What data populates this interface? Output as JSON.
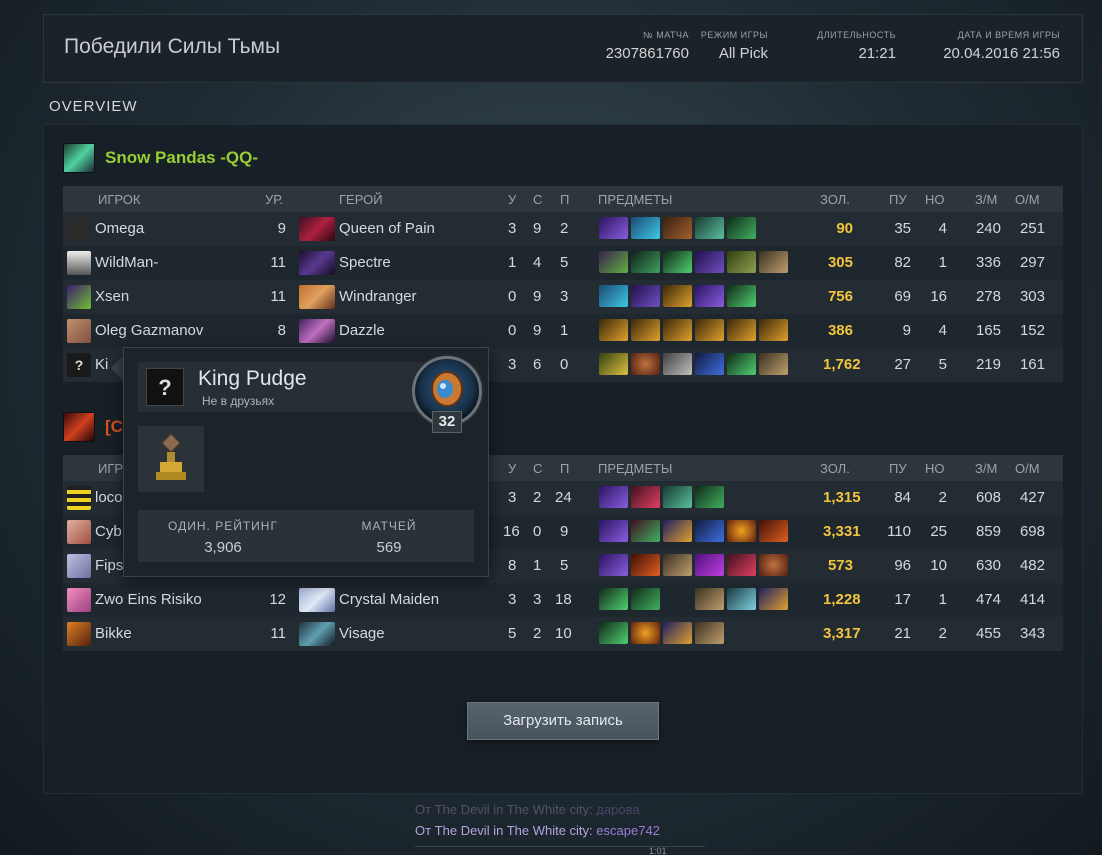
{
  "header": {
    "result": "Победили Силы Тьмы",
    "match_label": "№ МАТЧА",
    "match_value": "2307861760",
    "mode_label": "РЕЖИМ ИГРЫ",
    "mode_value": "All Pick",
    "duration_label": "ДЛИТЕЛЬНОСТЬ",
    "duration_value": "21:21",
    "date_label": "ДАТА И ВРЕМЯ ИГРЫ",
    "date_value": "20.04.2016 21:56"
  },
  "overview_label": "OVERVIEW",
  "columns": {
    "player": "ИГРОК",
    "level": "УР.",
    "hero": "ГЕРОЙ",
    "kills": "У",
    "deaths": "С",
    "assists": "П",
    "items": "ПРЕДМЕТЫ",
    "gold": "ЗОЛ.",
    "lh": "ПУ",
    "dn": "НО",
    "gpm": "З/М",
    "xpm": "О/М"
  },
  "colors": {
    "radiant": "#9acd32",
    "dire": "#d9531e",
    "gold": "#f2c53d"
  },
  "teams": [
    {
      "name": "Snow Pandas -QQ-",
      "players": [
        {
          "player": "Omega",
          "level": "9",
          "hero": "Queen of Pain",
          "k": "3",
          "d": "9",
          "a": "2",
          "gold": "90",
          "lh": "35",
          "dn": "4",
          "gpm": "240",
          "xpm": "251"
        },
        {
          "player": "WildMan-",
          "level": "11",
          "hero": "Spectre",
          "k": "1",
          "d": "4",
          "a": "5",
          "gold": "305",
          "lh": "82",
          "dn": "1",
          "gpm": "336",
          "xpm": "297"
        },
        {
          "player": "Xsen",
          "level": "11",
          "hero": "Windranger",
          "k": "0",
          "d": "9",
          "a": "3",
          "gold": "756",
          "lh": "69",
          "dn": "16",
          "gpm": "278",
          "xpm": "303"
        },
        {
          "player": "Oleg Gazmanov",
          "level": "8",
          "hero": "Dazzle",
          "k": "0",
          "d": "9",
          "a": "1",
          "gold": "386",
          "lh": "9",
          "dn": "4",
          "gpm": "165",
          "xpm": "152"
        },
        {
          "player": "Ki",
          "level": "",
          "hero": "",
          "k": "3",
          "d": "6",
          "a": "0",
          "gold": "1,762",
          "lh": "27",
          "dn": "5",
          "gpm": "219",
          "xpm": "161"
        }
      ]
    },
    {
      "name": "[C",
      "players": [
        {
          "player": "loco",
          "level": "",
          "hero": "",
          "k": "3",
          "d": "2",
          "a": "24",
          "gold": "1,315",
          "lh": "84",
          "dn": "2",
          "gpm": "608",
          "xpm": "427"
        },
        {
          "player": "Cyb",
          "level": "",
          "hero": "",
          "k": "16",
          "d": "0",
          "a": "9",
          "gold": "3,331",
          "lh": "110",
          "dn": "25",
          "gpm": "859",
          "xpm": "698"
        },
        {
          "player": "Fips",
          "level": "",
          "hero": "",
          "k": "8",
          "d": "1",
          "a": "5",
          "gold": "573",
          "lh": "96",
          "dn": "10",
          "gpm": "630",
          "xpm": "482"
        },
        {
          "player": "Zwo Eins Risiko",
          "level": "12",
          "hero": "Crystal Maiden",
          "k": "3",
          "d": "3",
          "a": "18",
          "gold": "1,228",
          "lh": "17",
          "dn": "1",
          "gpm": "474",
          "xpm": "414"
        },
        {
          "player": "Bikke",
          "level": "11",
          "hero": "Visage",
          "k": "5",
          "d": "2",
          "a": "10",
          "gold": "3,317",
          "lh": "21",
          "dn": "2",
          "gpm": "455",
          "xpm": "343"
        }
      ]
    }
  ],
  "load_button": "Загрузить запись",
  "chat": [
    {
      "from": "От The Devil in The White city:",
      "msg": "дарова"
    },
    {
      "from": "От The Devil in The White city:",
      "msg": "escape742"
    }
  ],
  "chat_time": "1:01",
  "popup": {
    "name": "King Pudge",
    "status": "Не в друзьях",
    "avatar_mark": "?",
    "rank_level": "32",
    "rating_label": "ОДИН. РЕЙТИНГ",
    "rating_value": "3,906",
    "matches_label": "МАТЧЕЙ",
    "matches_value": "569"
  },
  "row_avatar_mark": "?"
}
